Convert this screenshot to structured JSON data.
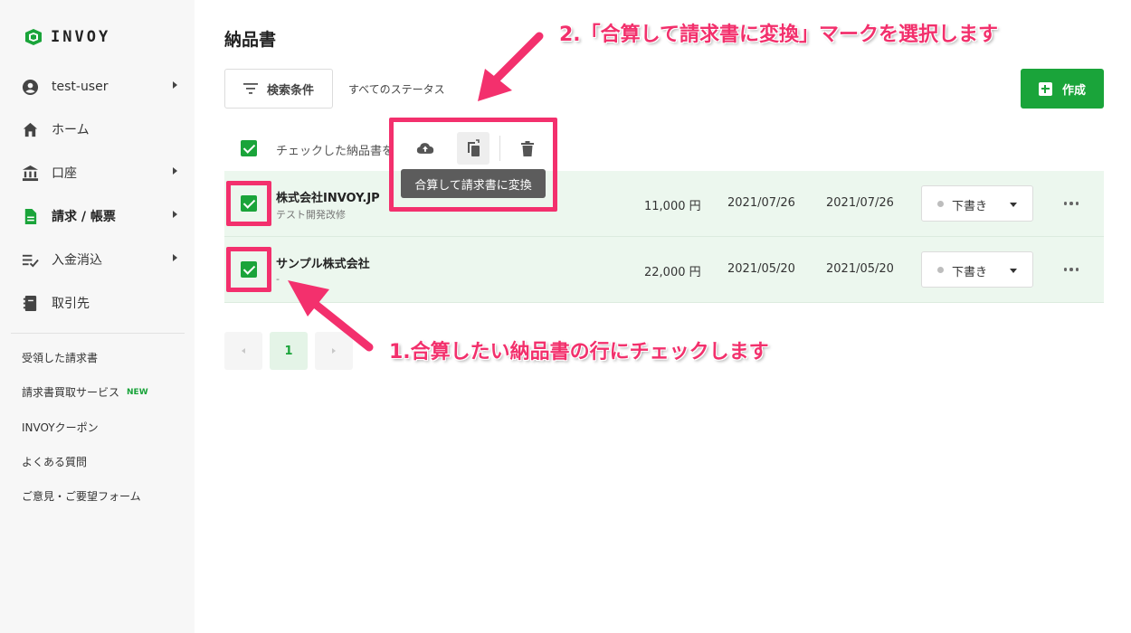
{
  "app": {
    "logo_text": "INVOY",
    "brand_color": "#1aa43a",
    "annotation_color": "#f3306d"
  },
  "sidebar": {
    "items": [
      {
        "label": "test-user",
        "icon": "account-circle-icon",
        "has_submenu": true
      },
      {
        "label": "ホーム",
        "icon": "home-icon",
        "has_submenu": false
      },
      {
        "label": "口座",
        "icon": "bank-icon",
        "has_submenu": true
      },
      {
        "label": "請求 / 帳票",
        "icon": "document-icon",
        "has_submenu": true,
        "active": true
      },
      {
        "label": "入金消込",
        "icon": "checklist-icon",
        "has_submenu": true
      },
      {
        "label": "取引先",
        "icon": "contacts-book-icon",
        "has_submenu": false
      }
    ],
    "links": [
      {
        "label": "受領した請求書"
      },
      {
        "label": "請求書買取サービス",
        "badge": "NEW"
      },
      {
        "label": "INVOYクーポン"
      },
      {
        "label": "よくある質問"
      },
      {
        "label": "ご意見・ご要望フォーム"
      }
    ]
  },
  "main": {
    "title": "納品書",
    "search_button": "検索条件",
    "status_filter": "すべてのステータス",
    "create_button": "作成",
    "bulk": {
      "label": "チェックした納品書を",
      "actions": [
        "cloud-upload-icon",
        "merge-convert-icon",
        "trash-icon"
      ],
      "tooltip": "合算して請求書に変換"
    },
    "rows": [
      {
        "company": "株式会社INVOY.JP",
        "subtitle": "テスト開発改修",
        "amount": "11,000 円",
        "date1": "2021/07/26",
        "date2": "2021/07/26",
        "status": "下書き",
        "checked": true
      },
      {
        "company": "サンプル株式会社",
        "subtitle": "-",
        "amount": "22,000 円",
        "date1": "2021/05/20",
        "date2": "2021/05/20",
        "status": "下書き",
        "checked": true
      }
    ],
    "pagination": {
      "current": "1"
    }
  },
  "annotations": {
    "step1": "1.合算したい納品書の行にチェックします",
    "step2": "2.「合算して請求書に変換」マークを選択します"
  }
}
